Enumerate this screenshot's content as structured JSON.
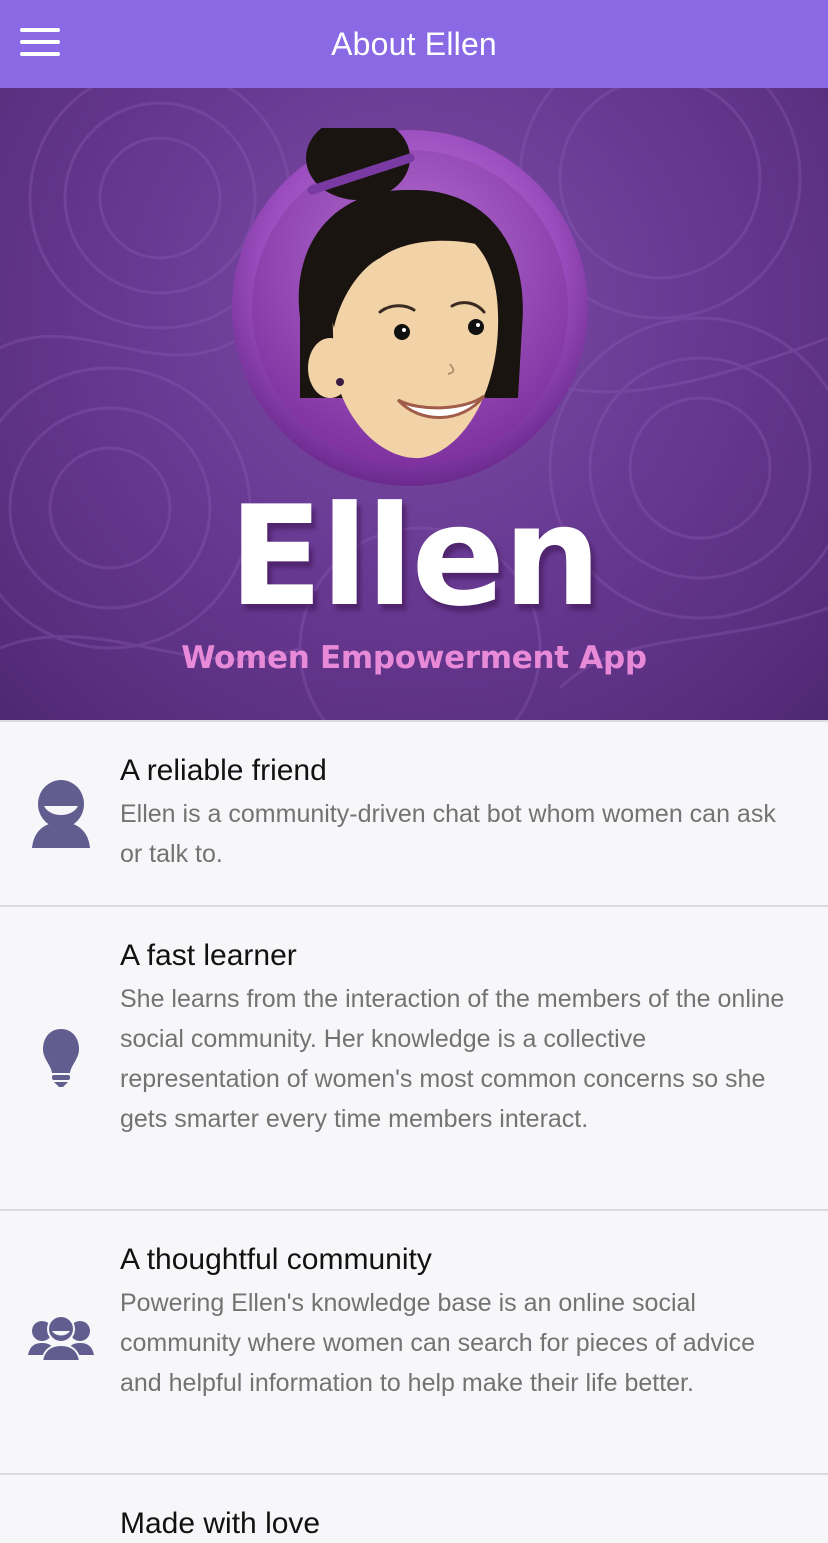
{
  "header": {
    "title": "About Ellen",
    "menu_icon": "hamburger-menu-icon"
  },
  "hero": {
    "name": "Ellen",
    "tagline": "Women Empowerment App",
    "colors": {
      "accent": "#8a6ae4",
      "background": "#6a3a94",
      "tagline": "#e98ad9"
    }
  },
  "features": [
    {
      "icon": "person-icon",
      "title": "A reliable friend",
      "description": "Ellen is a community-driven chat bot whom women can ask or talk to."
    },
    {
      "icon": "lightbulb-icon",
      "title": "A fast learner",
      "description": "She learns from the interaction of the members of the online social community. Her knowledge is a collective representation of women's most common concerns so she gets smarter every time members interact."
    },
    {
      "icon": "group-icon",
      "title": "A thoughtful community",
      "description": "Powering Ellen's knowledge base is an online social community where women can search for pieces of advice and helpful information to help make their life better."
    },
    {
      "icon": "heart-icon",
      "title": "Made with love",
      "description": ""
    }
  ]
}
